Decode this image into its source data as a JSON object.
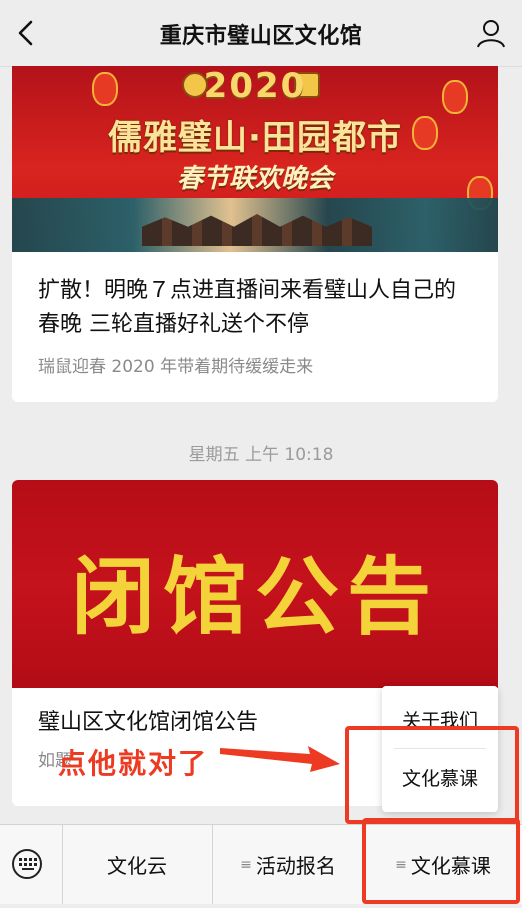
{
  "nav": {
    "title": "重庆市璧山区文化馆",
    "back_icon": "chevron-left-icon",
    "user_icon": "person-icon"
  },
  "article1": {
    "banner_year": "2020",
    "banner_headline": "儒雅璧山·田园都市",
    "banner_subhead": "春节联欢晚会",
    "title": "扩散！明晚７点进直播间来看璧山人自己的春晚 三轮直播好礼送个不停",
    "desc": "瑞鼠迎春 2020 年带着期待缓缓走来"
  },
  "timestamp": "星期五 上午 10:18",
  "article2": {
    "banner_text": "闭馆公告",
    "title": "璧山区文化馆闭馆公告",
    "desc": "如题"
  },
  "popup": {
    "items": [
      "关于我们",
      "文化慕课"
    ]
  },
  "annotation": {
    "text": "点他就对了",
    "color": "#ec3b22"
  },
  "bottom_menu": {
    "keyboard_icon": "keyboard-icon",
    "items": [
      "文化云",
      "活动报名",
      "文化慕课"
    ],
    "submenu_icon": "≡"
  }
}
